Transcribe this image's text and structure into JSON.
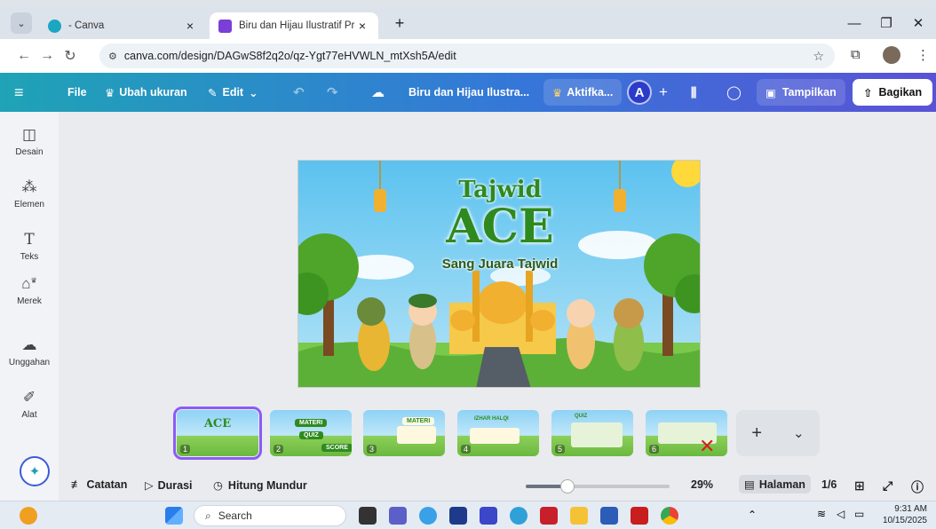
{
  "browser": {
    "tabs": [
      {
        "title": "- Canva",
        "close": "×"
      },
      {
        "title": "Biru dan Hijau Ilustratif Presenta",
        "close": "×"
      }
    ],
    "new_tab": "+",
    "window": {
      "minimize": "—",
      "maximize": "❐",
      "close": "✕"
    },
    "url": "canva.com/design/DAGwS8f2q2o/qz-Ygt77eHVWLN_mtXsh5A/edit"
  },
  "canva_bar": {
    "menu_icon": "≡",
    "file": "File",
    "resize": "Ubah ukuran",
    "edit": "Edit",
    "design_title": "Biru dan Hijau Ilustra...",
    "activate": "Aktifka...",
    "avatar_letter": "A",
    "present": "Tampilkan",
    "share": "Bagikan"
  },
  "sidebar": {
    "items": [
      {
        "label": "Desain",
        "icon": "design-icon"
      },
      {
        "label": "Elemen",
        "icon": "elements-icon"
      },
      {
        "label": "Teks",
        "icon": "text-icon"
      },
      {
        "label": "Merek",
        "icon": "brand-icon"
      },
      {
        "label": "Unggahan",
        "icon": "upload-icon"
      },
      {
        "label": "Alat",
        "icon": "tools-icon"
      }
    ]
  },
  "slide": {
    "title_top": "Tajwid",
    "title_main": "ACE",
    "subtitle": "Sang Juara Tajwid"
  },
  "thumbnails": [
    {
      "num": "1"
    },
    {
      "num": "2",
      "badges": [
        "MATERI",
        "QUIZ",
        "SCORE"
      ]
    },
    {
      "num": "3",
      "badges": [
        "MATERI"
      ]
    },
    {
      "num": "4",
      "badges": [
        "IZHAR HALQI"
      ]
    },
    {
      "num": "5",
      "badges": [
        "QUIZ"
      ]
    },
    {
      "num": "6"
    }
  ],
  "bottom_bar": {
    "notes": "Catatan",
    "duration": "Durasi",
    "countdown": "Hitung Mundur",
    "zoom": "29%",
    "zoom_level": 0.29,
    "pages_button": "Halaman",
    "page_counter": "1/6"
  },
  "taskbar": {
    "search": "Search",
    "time": "9:31 AM",
    "date": "10/15/2025"
  },
  "colors": {
    "canva_gradient_start": "#1fa3b6",
    "canva_gradient_end": "#5a52d6",
    "selected_outline": "#8b5cf6",
    "title_green": "#2e8a1f"
  }
}
